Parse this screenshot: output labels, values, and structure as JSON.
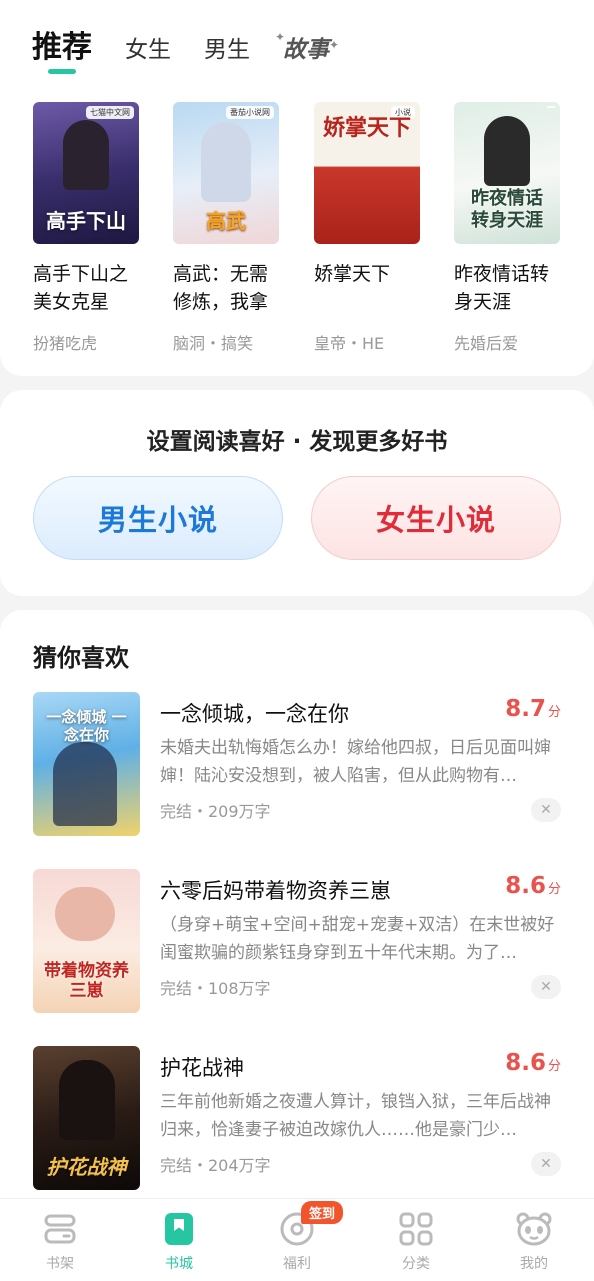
{
  "tabs": [
    "推荐",
    "女生",
    "男生",
    "故事"
  ],
  "recommend": [
    {
      "cover_title": "高手下山",
      "brand": "七猫中文网",
      "title": "高手下山之美女克星",
      "tags": "扮猪吃虎"
    },
    {
      "cover_title": "高武",
      "brand": "番茄小说网",
      "title": "高武：无需修炼，我拿",
      "tags": "脑洞・搞笑"
    },
    {
      "cover_title": "娇掌天下",
      "brand": "小说",
      "title": "娇掌天下",
      "tags": "皇帝・HE"
    },
    {
      "cover_title": "昨夜情话 转身天涯",
      "brand": "",
      "title": "昨夜情话转身天涯",
      "tags": "先婚后爱"
    }
  ],
  "preference": {
    "title": "设置阅读喜好 · 发现更多好书",
    "male": "男生小说",
    "female": "女生小说"
  },
  "guess": {
    "title": "猜你喜欢",
    "books": [
      {
        "cover_title": "一念倾城 一念在你",
        "title": "一念倾城，一念在你",
        "score": "8.7",
        "unit": "分",
        "desc": "未婚夫出轨悔婚怎么办！嫁给他四叔，日后见面叫婶婶！陆沁安没想到，被人陷害，但从此购物有…",
        "meta": "完结・209万字"
      },
      {
        "cover_title": "带着物资养三崽",
        "title": "六零后妈带着物资养三崽",
        "score": "8.6",
        "unit": "分",
        "desc": "（身穿+萌宝+空间+甜宠+宠妻+双洁）在末世被好闺蜜欺骗的颜紫钰身穿到五十年代末期。为了…",
        "meta": "完结・108万字"
      },
      {
        "cover_title": "护花战神",
        "title": "护花战神",
        "score": "8.6",
        "unit": "分",
        "desc": "三年前他新婚之夜遭人算计，锒铛入狱，三年后战神归来，恰逢妻子被迫改嫁仇人……他是豪门少…",
        "meta": "完结・204万字"
      }
    ]
  },
  "nav": [
    {
      "label": "书架",
      "icon": "bookshelf-icon"
    },
    {
      "label": "书城",
      "icon": "bookstore-icon",
      "active": true
    },
    {
      "label": "福利",
      "icon": "coin-icon",
      "badge": "签到"
    },
    {
      "label": "分类",
      "icon": "category-grid-icon"
    },
    {
      "label": "我的",
      "icon": "panda-avatar-icon"
    }
  ],
  "colors": {
    "accent": "#26c6a3",
    "score": "#e9534c",
    "male": "#1c79d8",
    "female": "#e02b39",
    "badge": "#f2552c"
  }
}
